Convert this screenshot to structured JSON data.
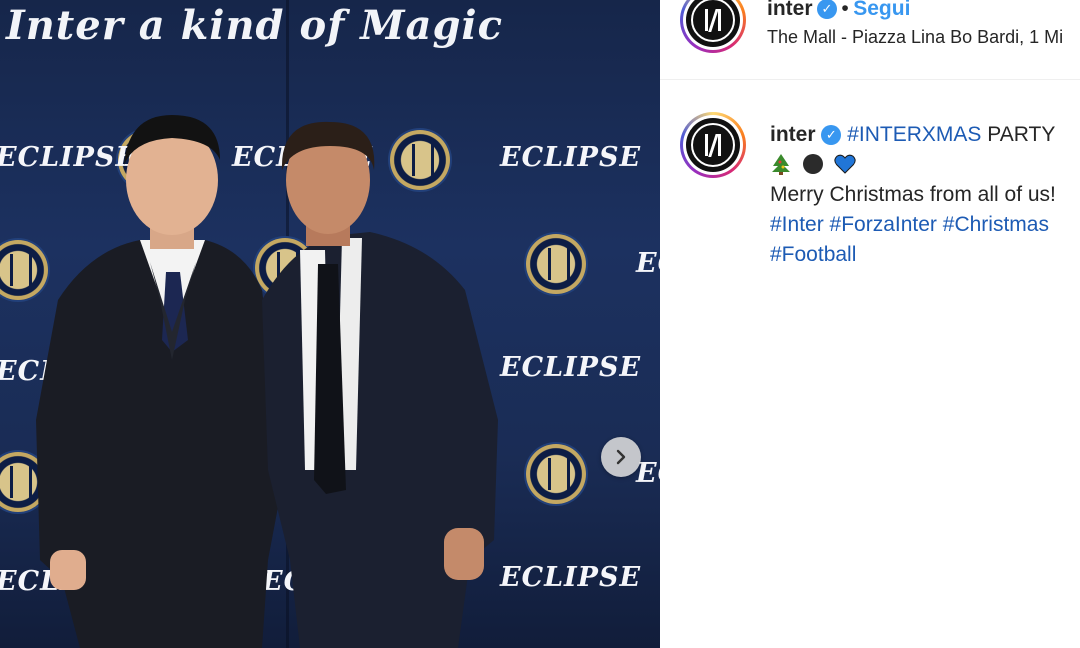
{
  "photo": {
    "tagline": "Inter a kind of Magic",
    "sponsor_word": "ECLIPSE",
    "next_button_label": "›"
  },
  "post": {
    "username": "inter",
    "verified": true,
    "separator": "•",
    "follow_label": "Segui",
    "location": "The Mall - Piazza Lina Bo Bardi, 1 Mi"
  },
  "caption": {
    "username": "inter",
    "title_hashtag": "#INTERXMAS",
    "title_rest": "PARTY",
    "emojis": [
      "christmas-tree",
      "black-circle",
      "blue-heart"
    ],
    "message": "Merry Christmas from all of us!",
    "hashtags_line1": [
      "#Inter",
      "#ForzaInter",
      "#Christmas"
    ],
    "hashtags_line2": [
      "#Football"
    ]
  },
  "colors": {
    "accent_blue": "#3897f0",
    "hashtag": "#1d5bb4",
    "text": "#262626",
    "backdrop": "#1c3160"
  }
}
